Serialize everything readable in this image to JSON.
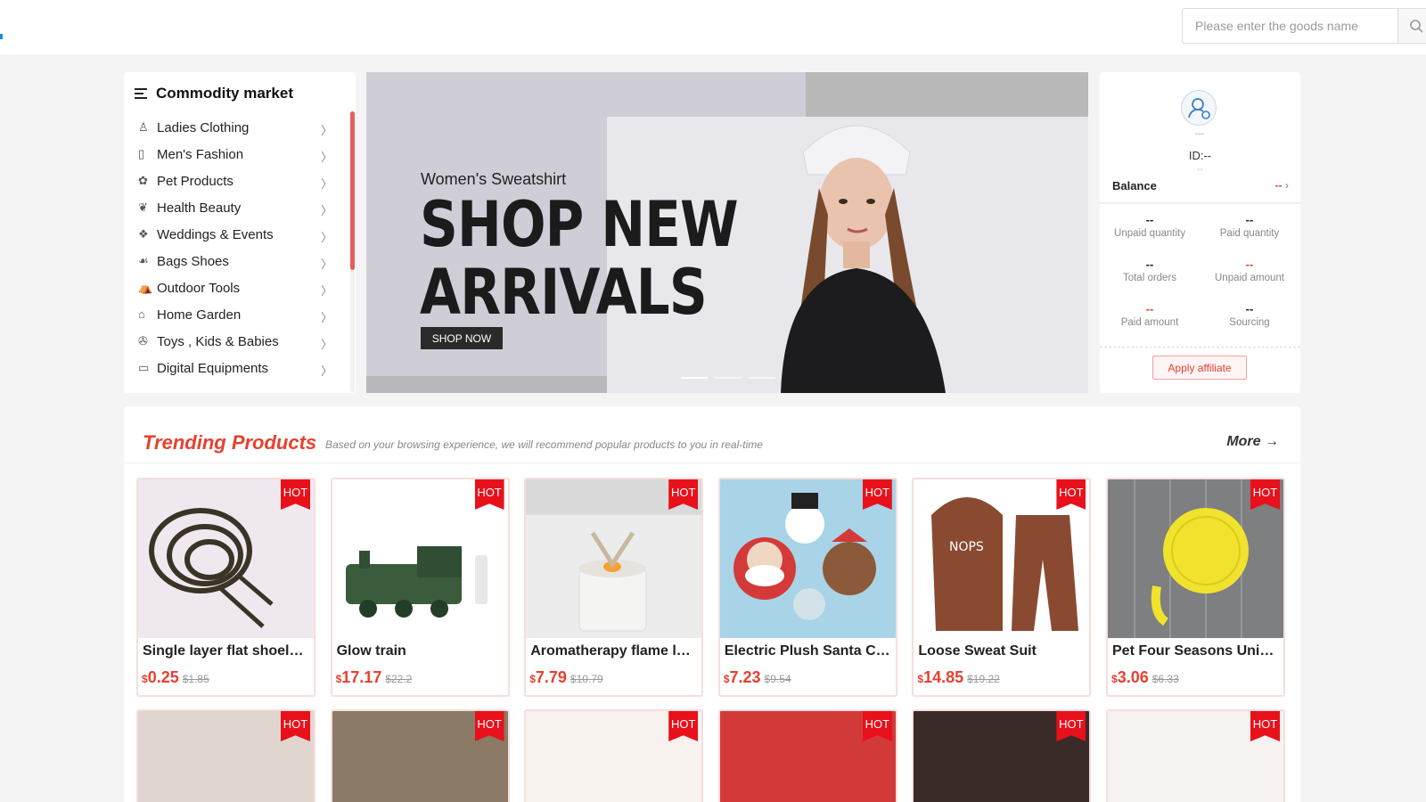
{
  "search": {
    "placeholder": "Please enter the goods name"
  },
  "category": {
    "title": "Commodity market",
    "items": [
      {
        "label": "Ladies Clothing",
        "icon": "dress-icon"
      },
      {
        "label": "Men's Fashion",
        "icon": "shirt-icon"
      },
      {
        "label": "Pet Products",
        "icon": "paw-icon"
      },
      {
        "label": "Health Beauty",
        "icon": "beauty-icon"
      },
      {
        "label": "Weddings & Events",
        "icon": "gift-icon"
      },
      {
        "label": "Bags Shoes",
        "icon": "shoe-icon"
      },
      {
        "label": "Outdoor Tools",
        "icon": "tent-icon"
      },
      {
        "label": "Home Garden",
        "icon": "home-icon"
      },
      {
        "label": "Toys , Kids & Babies",
        "icon": "toy-icon"
      },
      {
        "label": "Digital Equipments",
        "icon": "monitor-icon"
      }
    ]
  },
  "banner": {
    "subtitle": "Women's Sweatshirt",
    "title_line1": "SHOP NEW",
    "title_line2": "ARRIVALS",
    "button": "SHOP NOW"
  },
  "user": {
    "id_label": "ID:--",
    "sub": "--",
    "balance_label": "Balance",
    "balance_value": "--",
    "stats": [
      {
        "value": "--",
        "label": "Unpaid quantity",
        "red": false
      },
      {
        "value": "--",
        "label": "Paid quantity",
        "red": false
      },
      {
        "value": "--",
        "label": "Total orders",
        "red": false
      },
      {
        "value": "--",
        "label": "Unpaid amount",
        "red": true
      },
      {
        "value": "--",
        "label": "Paid amount",
        "red": true
      },
      {
        "value": "--",
        "label": "Sourcing",
        "red": false
      }
    ],
    "affiliate_button": "Apply affiliate"
  },
  "trending": {
    "title": "Trending Products",
    "subtitle": "Based on your browsing experience, we will recommend popular products to you in real-time",
    "more": "More",
    "hot_label": "HOT",
    "currency": "$",
    "products": [
      {
        "name": "Single layer flat shoelace",
        "price": "0.25",
        "old": "$1.85",
        "img": "shoelace"
      },
      {
        "name": "Glow train",
        "price": "17.17",
        "old": "$22.2",
        "img": "train"
      },
      {
        "name": "Aromatherapy flame lamp",
        "price": "7.79",
        "old": "$10.79",
        "img": "lamp"
      },
      {
        "name": "Electric Plush Santa Claus",
        "price": "7.23",
        "old": "$9.54",
        "img": "santa"
      },
      {
        "name": "Loose Sweat Suit",
        "price": "14.85",
        "old": "$19.22",
        "img": "suit"
      },
      {
        "name": "Pet Four Seasons Universal",
        "price": "3.06",
        "old": "$6.33",
        "img": "petmat"
      }
    ]
  },
  "colors": {
    "accent": "#e8402f",
    "hot": "#e8111b",
    "banner_bg": "#cfced7"
  }
}
